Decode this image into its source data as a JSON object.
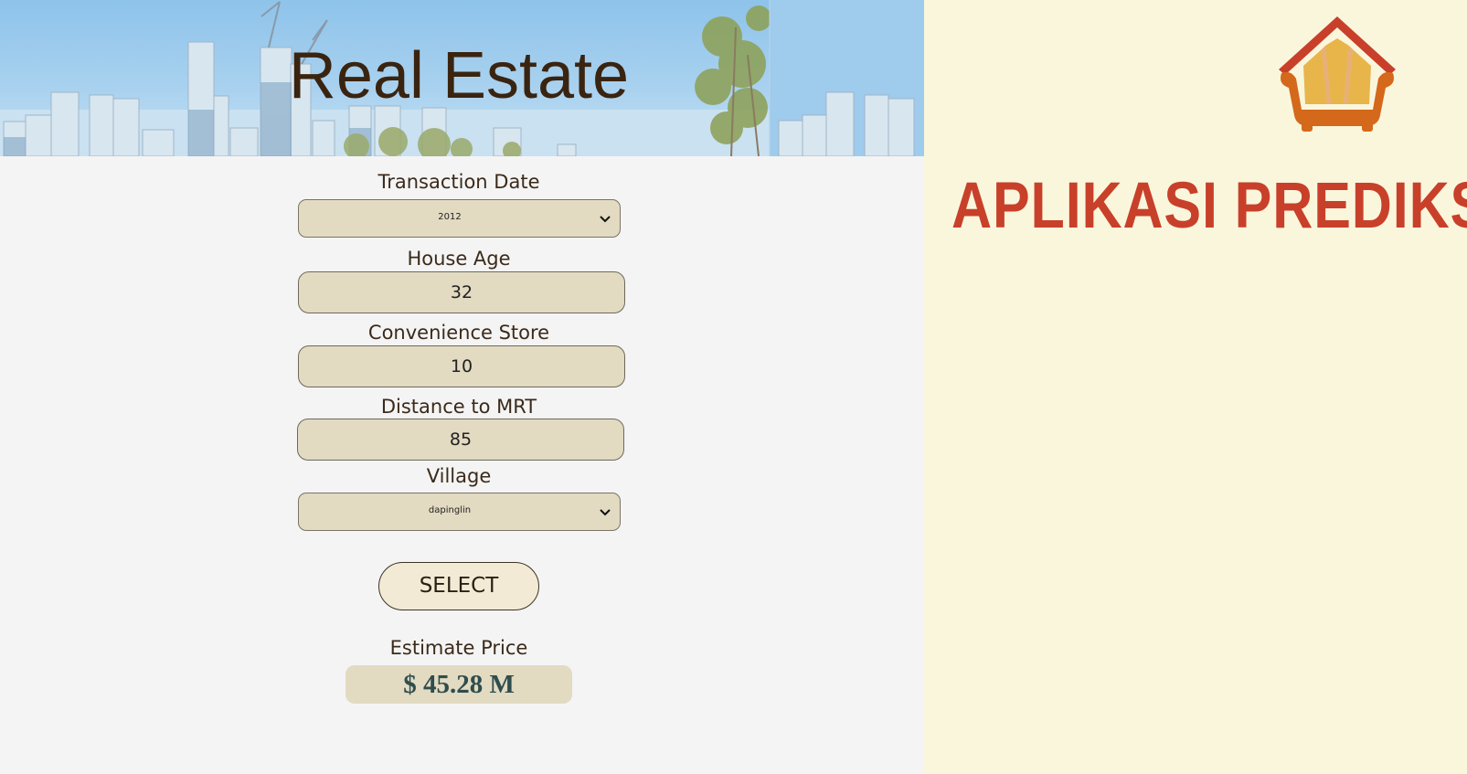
{
  "header": {
    "title": "Real Estate"
  },
  "form": {
    "transaction_date": {
      "label": "Transaction Date",
      "value": "2012"
    },
    "house_age": {
      "label": "House Age",
      "value": "32"
    },
    "convenience_store": {
      "label": "Convenience Store",
      "value": "10"
    },
    "distance_to_mrt": {
      "label": "Distance to MRT",
      "value": "85"
    },
    "village": {
      "label": "Village",
      "value": "dapinglin"
    },
    "submit_label": "SELECT"
  },
  "result": {
    "label": "Estimate Price",
    "value": "$ 45.28 M"
  },
  "side_panel": {
    "title": "APLIKASI PREDIKSI",
    "logo_icon": "sofa-house-logo-icon"
  },
  "colors": {
    "input_bg": "#e2dac1",
    "side_bg": "#faf6dc",
    "title_red": "#c8402a",
    "result_text": "#2f4d4d"
  }
}
